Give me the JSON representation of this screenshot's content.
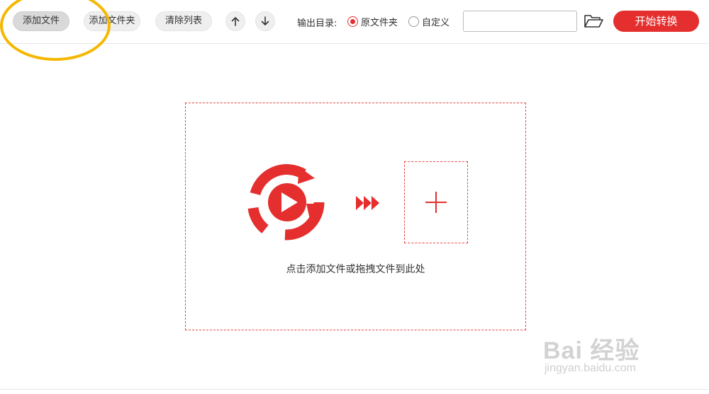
{
  "toolbar": {
    "add_file_label": "添加文件",
    "add_folder_label": "添加文件夹",
    "clear_list_label": "清除列表",
    "move_up_icon": "arrow-up-icon",
    "move_down_icon": "arrow-down-icon",
    "output_dir_label": "输出目录:",
    "radio_original_label": "原文件夹",
    "radio_custom_label": "自定义",
    "selected_output": "原文件夹",
    "path_value": "",
    "path_placeholder": "",
    "folder_icon": "folder-open-icon",
    "start_label": "开始转换"
  },
  "drop_zone": {
    "hint": "点击添加文件或拖拽文件到此处",
    "logo_icon": "video-convert-icon",
    "arrows_icon": "triple-arrow-icon",
    "plus_icon": "plus-icon"
  },
  "watermark": {
    "main": "Bai 经验",
    "sub": "jingyan.baidu.com"
  },
  "colors": {
    "accent": "#e52e2e",
    "annotation": "#f5b700"
  }
}
